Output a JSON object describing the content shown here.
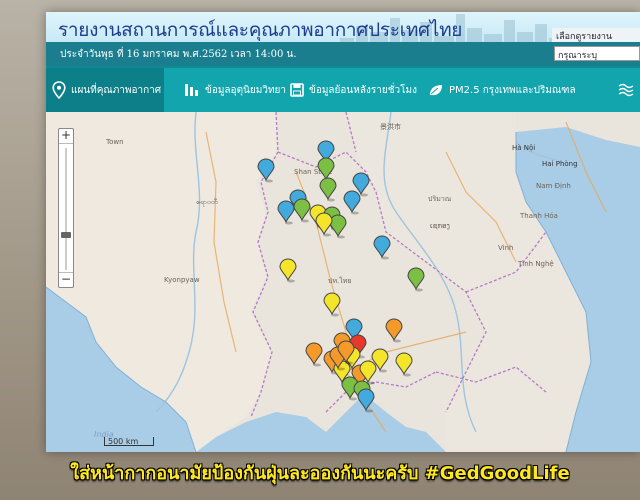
{
  "header": {
    "title": "รายงานสถานการณ์และคุณภาพอากาศประเทศไทย",
    "date": "ประจำวันพุธ ที่ 16 มกราคม พ.ศ.2562 เวลา 14:00 น.",
    "select_label": "เลือกดูรายงาน",
    "select_value": "กรุณาระบุ"
  },
  "nav": {
    "items": [
      {
        "label": "แผนที่คุณภาพอากาศ",
        "icon": "map-pin-icon"
      },
      {
        "label": "ข้อมูลอุตุนิยมวิทยา",
        "icon": "weather-icon"
      },
      {
        "label": "ข้อมูลย้อนหลังรายชั่วโมง",
        "icon": "save-icon"
      },
      {
        "label": "PM2.5 กรุงเทพและปริมณฑล",
        "icon": "leaf-icon"
      }
    ]
  },
  "map": {
    "scale_label": "500 km",
    "places": [
      {
        "text": "Hà Nội",
        "type": "city"
      },
      {
        "text": "Hai Phòng",
        "type": "city"
      },
      {
        "text": "Nam Định",
        "type": "city"
      },
      {
        "text": "Thanh Hóa",
        "type": "town"
      },
      {
        "text": "Vinh",
        "type": "town"
      },
      {
        "text": "Tĩnh Nghệ",
        "type": "town"
      },
      {
        "text": "Shan State",
        "type": "town"
      },
      {
        "text": "景洪市",
        "type": "town"
      },
      {
        "text": "ปริมาณ",
        "type": "town"
      },
      {
        "text": "ເຊກອງ",
        "type": "town"
      },
      {
        "text": "ဧရာဝတီ",
        "type": "town"
      },
      {
        "text": "Kyonpyaw",
        "type": "town"
      },
      {
        "text": "India",
        "type": "sea"
      },
      {
        "text": "Town",
        "type": "town"
      },
      {
        "text": "ปท.ไทย",
        "type": "town"
      }
    ],
    "status_colors": {
      "blue": "#42aadc",
      "green": "#7cbf45",
      "yellow": "#f5e52a",
      "orange": "#f39a2b",
      "red": "#e53a2b"
    }
  },
  "caption": "ใส่หน้ากากอนามัยป้องกันฝุ่นละอองกันนะครับ #GedGoodLife"
}
